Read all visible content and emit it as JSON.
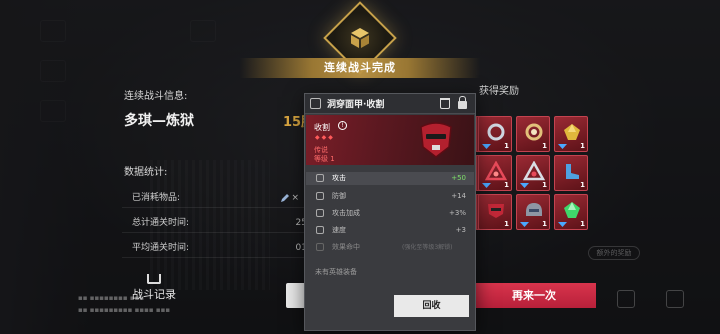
{
  "header": {
    "banner": "连续战斗完成"
  },
  "summary": {
    "section_label": "连续战斗信息:",
    "stage_name": "多琪—炼狱",
    "win_count": "15胜",
    "stats_label": "数据统计:",
    "rows": [
      {
        "label": "已消耗物品:",
        "value": "×"
      },
      {
        "label": "总计通关时间:",
        "value": "25"
      },
      {
        "label": "平均通关时间:",
        "value": "01"
      }
    ]
  },
  "rewards": {
    "title": "获得奖励",
    "counts": [
      "1",
      "1",
      "1",
      "1",
      "1",
      "1",
      "1",
      "1",
      "1",
      "1",
      "1",
      "1"
    ],
    "faded_button": "额外的奖励"
  },
  "footer": {
    "record_label": "战斗记录",
    "again_label": "再来一次"
  },
  "popup": {
    "title": "洞穿面甲·收割",
    "item_name": "收割",
    "rarity": "传说",
    "level": "等级 1",
    "attributes": [
      {
        "name": "攻击",
        "value": "+50",
        "style": "main"
      },
      {
        "name": "防御",
        "value": "+14",
        "style": "sub"
      },
      {
        "name": "攻击加成",
        "value": "+3%",
        "style": "sub"
      },
      {
        "name": "速度",
        "value": "+3",
        "style": "sub"
      },
      {
        "name": "效果命中",
        "value": "",
        "note": "(强化至等级3解锁)",
        "style": "locked"
      }
    ],
    "equipped_text": "未有英雄装备",
    "recycle_label": "回收",
    "accent_color": "#7a1e28"
  }
}
